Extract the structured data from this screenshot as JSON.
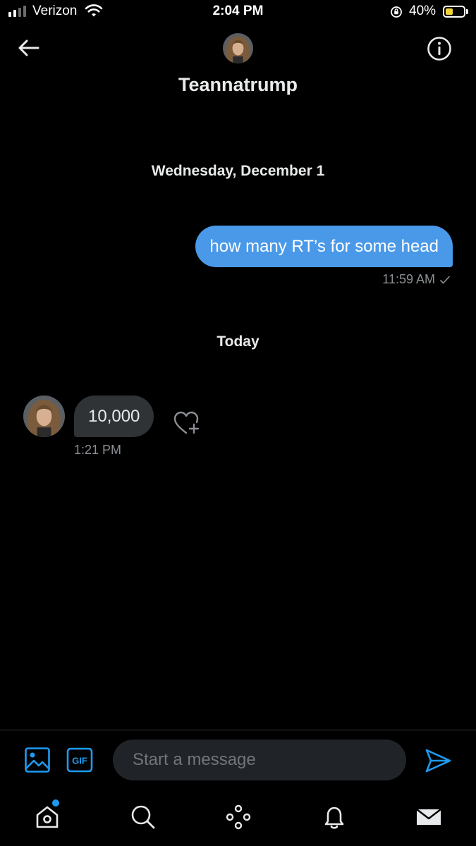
{
  "status_bar": {
    "carrier": "Verizon",
    "time": "2:04 PM",
    "battery_percent": "40%",
    "battery_level": 0.4,
    "signal_bars": 4,
    "signal_bars_active": 2
  },
  "header": {
    "name": "Teannatrump",
    "icons": {
      "back": "back-arrow-icon",
      "info": "info-icon",
      "avatar": "avatar"
    }
  },
  "conversation": {
    "groups": [
      {
        "date_label": "Wednesday, December 1",
        "messages": [
          {
            "direction": "sent",
            "text": "how many RT’s for some head",
            "time": "11:59 AM",
            "status_icon": "checkmark-icon"
          }
        ]
      },
      {
        "date_label": "Today",
        "messages": [
          {
            "direction": "received",
            "text": "10,000",
            "time": "1:21 PM",
            "reaction_icon": "heart-plus-icon"
          }
        ]
      }
    ]
  },
  "composer": {
    "placeholder": "Start a message",
    "value": "",
    "media_icon": "image-icon",
    "gif_label": "GIF",
    "send_icon": "send-icon"
  },
  "tab_bar": {
    "items": [
      {
        "name": "home",
        "icon": "home-icon",
        "has_notification_dot": true
      },
      {
        "name": "search",
        "icon": "search-icon"
      },
      {
        "name": "spaces",
        "icon": "spaces-icon"
      },
      {
        "name": "notifications",
        "icon": "bell-icon"
      },
      {
        "name": "messages",
        "icon": "mail-icon",
        "active": true
      }
    ]
  },
  "colors": {
    "background": "#000000",
    "accent": "#1d9bf0",
    "sent_bubble": "#4a99e9",
    "received_bubble": "#2f3336",
    "battery_fill": "#f2d43a",
    "muted_text": "#8b8f93"
  }
}
